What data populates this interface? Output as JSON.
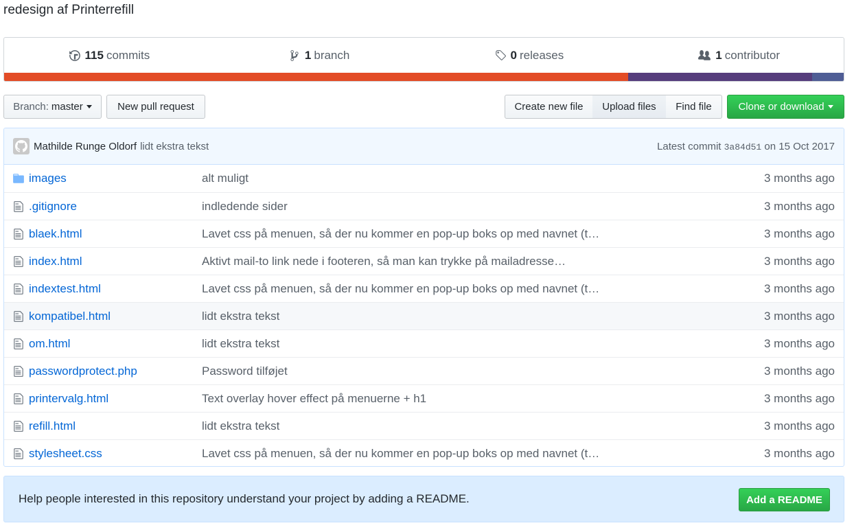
{
  "repo": {
    "description": "redesign af Printerrefill"
  },
  "summary": {
    "commits": {
      "count": "115",
      "label": "commits",
      "icon": "history-icon"
    },
    "branches": {
      "count": "1",
      "label": "branch",
      "icon": "git-branch-icon"
    },
    "releases": {
      "count": "0",
      "label": "releases",
      "icon": "tag-icon"
    },
    "contributors": {
      "count": "1",
      "label": "contributor",
      "icon": "organization-icon"
    },
    "languages": [
      {
        "color": "#e34c26",
        "fraction": 0.743
      },
      {
        "color": "#563d7c",
        "fraction": 0.219
      },
      {
        "color": "#4f5d95",
        "fraction": 0.038
      }
    ]
  },
  "toolbar": {
    "branch_prefix": "Branch:",
    "branch_name": "master",
    "new_pull_request": "New pull request",
    "create_new_file": "Create new file",
    "upload_files": "Upload files",
    "find_file": "Find file",
    "clone_or_download": "Clone or download"
  },
  "commit_tease": {
    "author": "Mathilde Runge Oldorf",
    "message": "lidt ekstra tekst",
    "latest_prefix": "Latest commit",
    "sha": "3a84d51",
    "date_prefix": "on",
    "date": "15 Oct 2017"
  },
  "files": [
    {
      "type": "directory",
      "name": "images",
      "message": "alt muligt",
      "age": "3 months ago"
    },
    {
      "type": "file",
      "name": ".gitignore",
      "message": "indledende sider",
      "age": "3 months ago"
    },
    {
      "type": "file",
      "name": "blaek.html",
      "message": "Lavet css på menuen, så der nu kommer en pop-up boks op med navnet (t…",
      "age": "3 months ago"
    },
    {
      "type": "file",
      "name": "index.html",
      "message": "Aktivt mail-to link nede i footeren, så man kan trykke på mailadresse…",
      "age": "3 months ago"
    },
    {
      "type": "file",
      "name": "indextest.html",
      "message": "Lavet css på menuen, så der nu kommer en pop-up boks op med navnet (t…",
      "age": "3 months ago"
    },
    {
      "type": "file",
      "name": "kompatibel.html",
      "message": "lidt ekstra tekst",
      "age": "3 months ago"
    },
    {
      "type": "file",
      "name": "om.html",
      "message": "lidt ekstra tekst",
      "age": "3 months ago"
    },
    {
      "type": "file",
      "name": "passwordprotect.php",
      "message": "Password tilføjet",
      "age": "3 months ago"
    },
    {
      "type": "file",
      "name": "printervalg.html",
      "message": "Text overlay hover effect på menuerne + h1",
      "age": "3 months ago"
    },
    {
      "type": "file",
      "name": "refill.html",
      "message": "lidt ekstra tekst",
      "age": "3 months ago"
    },
    {
      "type": "file",
      "name": "stylesheet.css",
      "message": "Lavet css på menuen, så der nu kommer en pop-up boks op med navnet (t…",
      "age": "3 months ago"
    }
  ],
  "readme_banner": {
    "text": "Help people interested in this repository understand your project by adding a README.",
    "button": "Add a README"
  }
}
